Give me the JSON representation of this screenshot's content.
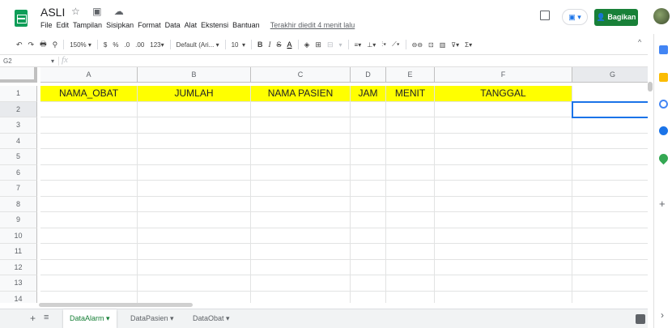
{
  "header": {
    "title": "ASLI",
    "title_icons": "☆ ▣ ☁",
    "menu": [
      "File",
      "Edit",
      "Tampilan",
      "Sisipkan",
      "Format",
      "Data",
      "Alat",
      "Ekstensi",
      "Bantuan"
    ],
    "last_edit": "Terakhir diedit 4 menit lalu",
    "share_label": "Bagikan",
    "present_label": "▣ ▾"
  },
  "toolbar": {
    "undo": "↶",
    "redo": "↷",
    "print": "🖶",
    "paint": "⚲",
    "zoom": "150%",
    "zoom_drop": "▾",
    "currency": "$",
    "percent": "%",
    "dec_minus": ".0",
    "dec_plus": ".00",
    "more_formats": "123▾",
    "font": "Default (Ari...",
    "font_drop": "▾",
    "font_size": "10",
    "font_size_drop": "▾",
    "bold": "B",
    "italic": "I",
    "strike": "S",
    "text_color": "A",
    "fill": "◈",
    "borders": "⊞",
    "merge": "⊟",
    "merge_drop": "▾",
    "halign": "≡▾",
    "valign": "⊥▾",
    "wrap": "⫶▾",
    "rotate": "⟋▾",
    "link": "⊖⊖",
    "comment": "⊡",
    "chart": "▥",
    "filter": "⊽▾",
    "functions": "Σ▾",
    "collapse": "^"
  },
  "formula_bar": {
    "cell_ref": "G2",
    "dropdown": "▾",
    "fx": "fx"
  },
  "grid": {
    "columns": [
      "A",
      "B",
      "C",
      "D",
      "E",
      "F",
      "G"
    ],
    "rows": [
      "1",
      "2",
      "3",
      "4",
      "5",
      "6",
      "7",
      "8",
      "9",
      "10",
      "11",
      "12",
      "13",
      "14"
    ],
    "header_row": [
      "NAMA_OBAT",
      "JUMLAH",
      "NAMA PASIEN",
      "JAM",
      "MENIT",
      "TANGGAL",
      ""
    ],
    "active_cell": "G2",
    "header_fill": "#ffff00",
    "selection_color": "#1a73e8"
  },
  "sheets": {
    "add": "+",
    "list": "≡",
    "tabs": [
      {
        "label": "DataAlarm ▾",
        "active": true
      },
      {
        "label": "DataPasien ▾",
        "active": false
      },
      {
        "label": "DataObat ▾",
        "active": false
      }
    ]
  },
  "side_panel": {
    "expand": "›",
    "add": "+"
  }
}
